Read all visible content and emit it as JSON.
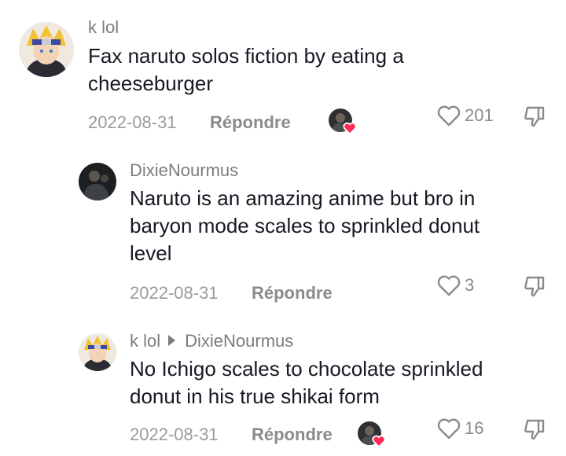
{
  "comments": [
    {
      "username": "k lol",
      "text_lines": [
        "Fax naruto solos fiction by eating a",
        "cheeseburger"
      ],
      "date": "2022-08-31",
      "reply_label": "Répondre",
      "likes": "201"
    },
    {
      "username": "DixieNourmus",
      "text_lines": [
        "Naruto is an amazing anime but bro in",
        "baryon mode scales to sprinkled donut",
        "level"
      ],
      "date": "2022-08-31",
      "reply_label": "Répondre",
      "likes": "3"
    },
    {
      "username": "k lol",
      "reply_to": "DixieNourmus",
      "text_lines": [
        "No Ichigo scales to chocolate sprinkled",
        "donut in his true shikai form"
      ],
      "date": "2022-08-31",
      "reply_label": "Répondre",
      "likes": "16"
    }
  ],
  "colors": {
    "text": "#161823",
    "muted": "#8a8a8f",
    "heart": "#fe2c55"
  }
}
